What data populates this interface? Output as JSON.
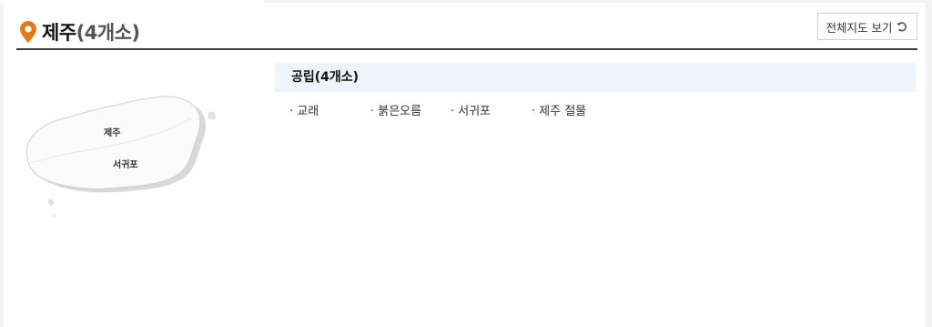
{
  "header": {
    "region": "제주",
    "count": "(4개소)",
    "view_all_label": "전체지도 보기"
  },
  "map": {
    "labels": [
      "제주",
      "서귀포"
    ]
  },
  "category": {
    "label": "공립(4개소)",
    "places": [
      "· 교래",
      "· 붉은오름",
      "· 서귀포",
      "· 제주 절물"
    ]
  },
  "colors": {
    "pin": "#e07b16",
    "header_rule": "#3a3a3a",
    "category_bg": "#eef4fb"
  },
  "icons": {
    "pin": "map-pin-icon",
    "refresh": "refresh-icon"
  }
}
